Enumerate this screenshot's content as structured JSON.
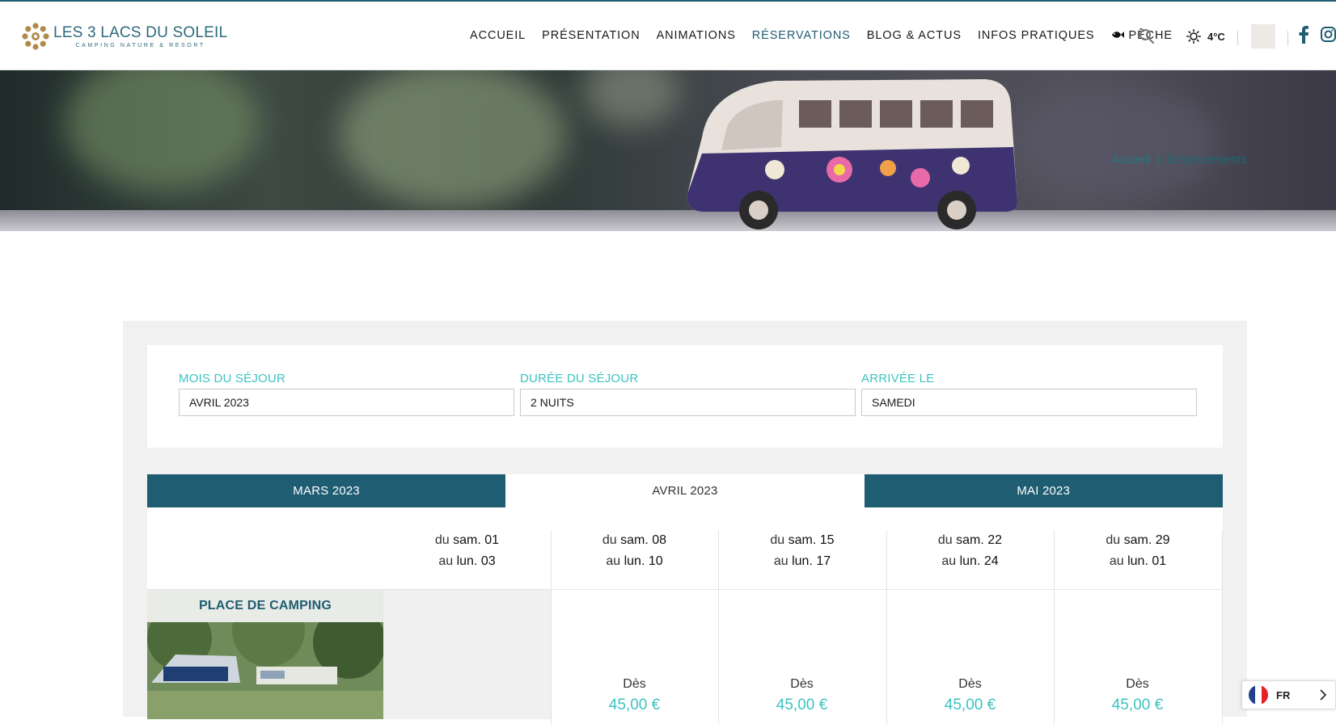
{
  "header": {
    "logo_title": "LES 3 LACS DU SOLEIL",
    "logo_subtitle": "CAMPING NATURE & RESORT",
    "nav": [
      {
        "label": "ACCUEIL"
      },
      {
        "label": "PRÉSENTATION"
      },
      {
        "label": "ANIMATIONS"
      },
      {
        "label": "RÉSERVATIONS",
        "active": true
      },
      {
        "label": "BLOG & ACTUS"
      },
      {
        "label": "INFOS PRATIQUES"
      },
      {
        "label": "PÊCHE",
        "icon": "fish-icon"
      }
    ],
    "weather_temp": "4°C",
    "accent_color": "#1f5d72"
  },
  "hero": {
    "breadcrumb": {
      "home": "Accueil",
      "separator": "|",
      "current": "Emplacements"
    }
  },
  "filters": {
    "month": {
      "label": "MOIS DU SÉJOUR",
      "value": "AVRIL 2023"
    },
    "duration": {
      "label": "DURÉE DU SÉJOUR",
      "value": "2 NUITS"
    },
    "arrival": {
      "label": "ARRIVÉE LE",
      "value": "SAMEDI"
    }
  },
  "month_tabs": [
    {
      "label": "MARS 2023",
      "selected": false
    },
    {
      "label": "AVRIL 2023",
      "selected": true
    },
    {
      "label": "MAI 2023",
      "selected": false
    }
  ],
  "periods": [
    {
      "from_prefix": "du",
      "from": "sam. 01",
      "to_prefix": "au",
      "to": "lun. 03"
    },
    {
      "from_prefix": "du",
      "from": "sam. 08",
      "to_prefix": "au",
      "to": "lun. 10"
    },
    {
      "from_prefix": "du",
      "from": "sam. 15",
      "to_prefix": "au",
      "to": "lun. 17"
    },
    {
      "from_prefix": "du",
      "from": "sam. 22",
      "to_prefix": "au",
      "to": "lun. 24"
    },
    {
      "from_prefix": "du",
      "from": "sam. 29",
      "to_prefix": "au",
      "to": "lun. 01"
    }
  ],
  "product": {
    "title": "PLACE DE CAMPING",
    "prices": [
      {
        "from_label": "Dès",
        "amount": "45,00 €"
      },
      {
        "from_label": "Dès",
        "amount": "45,00 €"
      },
      {
        "from_label": "Dès",
        "amount": "45,00 €"
      },
      {
        "from_label": "Dès",
        "amount": "45,00 €"
      }
    ]
  },
  "language": {
    "code": "FR"
  },
  "colors": {
    "teal": "#3cc3c0",
    "dark_teal": "#1f5d72"
  }
}
